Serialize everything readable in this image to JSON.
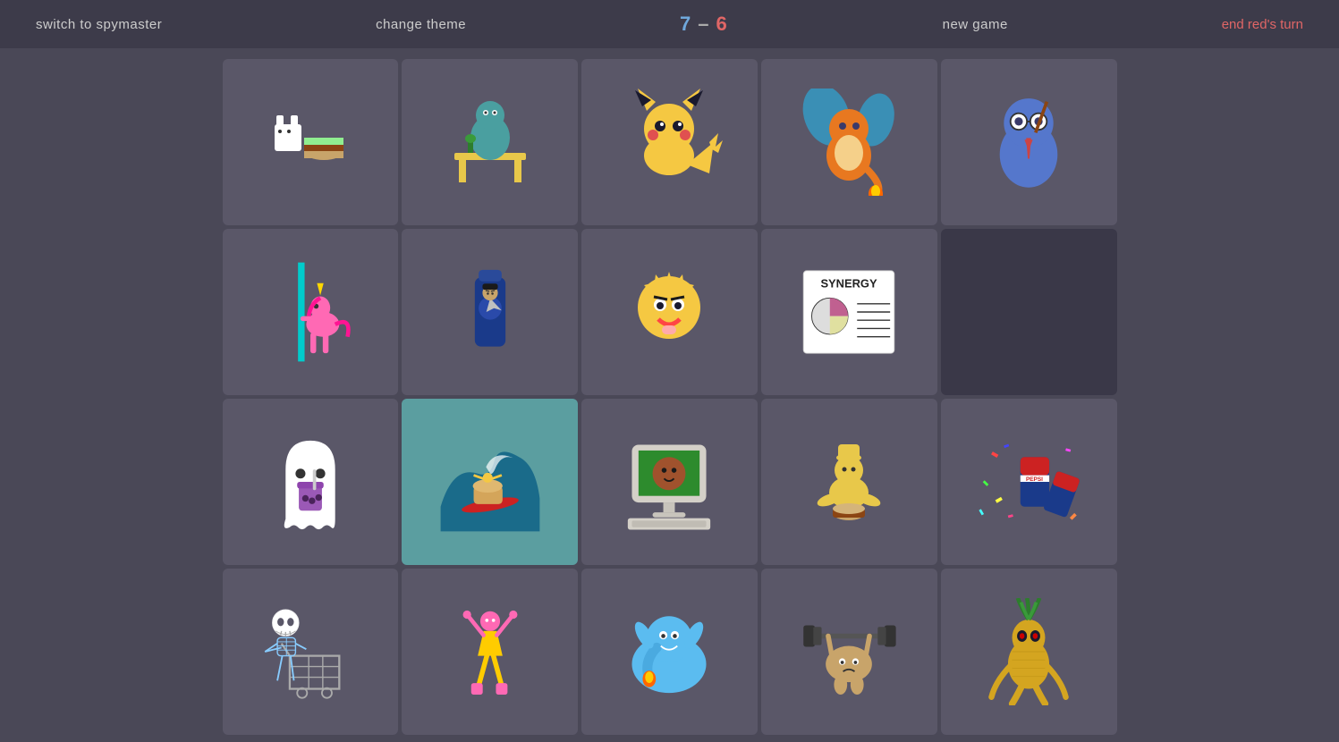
{
  "header": {
    "switch_label": "switch to spymaster",
    "theme_label": "change theme",
    "score_blue": "7",
    "score_sep": "–",
    "score_red": "6",
    "new_game_label": "new game",
    "end_turn_label": "end red's turn"
  },
  "cards": [
    {
      "id": 0,
      "emoji": "🐱🍔",
      "label": "cat burger",
      "bg": "#5a5768"
    },
    {
      "id": 1,
      "emoji": "🦕💻",
      "label": "dino desk",
      "bg": "#5a5768"
    },
    {
      "id": 2,
      "emoji": "⚡🐭",
      "label": "pikachu",
      "bg": "#5a5768"
    },
    {
      "id": 3,
      "emoji": "🐉🔥",
      "label": "charizard",
      "bg": "#5a5768"
    },
    {
      "id": 4,
      "emoji": "🦉🎓",
      "label": "owl professor",
      "bg": "#5a5768"
    },
    {
      "id": 5,
      "emoji": "🦄💃",
      "label": "unicorn pole",
      "bg": "#5a5768"
    },
    {
      "id": 6,
      "emoji": "🖖🧴",
      "label": "spock bottle",
      "bg": "#5a5768"
    },
    {
      "id": 7,
      "emoji": "⭐😤",
      "label": "maggie simpson",
      "bg": "#5a5768"
    },
    {
      "id": 8,
      "emoji": "📊✏️",
      "label": "synergy chart",
      "bg": "#5a5768"
    },
    {
      "id": 9,
      "emoji": "🌑",
      "label": "dark card",
      "bg": "#5a5768"
    },
    {
      "id": 10,
      "emoji": "👻🧋",
      "label": "ghost boba",
      "bg": "#5a5768"
    },
    {
      "id": 11,
      "emoji": "🌊🍞",
      "label": "bread surfing",
      "bg": "#5a5768"
    },
    {
      "id": 12,
      "emoji": "💻👶",
      "label": "old computer",
      "bg": "#5a5768"
    },
    {
      "id": 13,
      "emoji": "🥁🧘",
      "label": "meditating drummer",
      "bg": "#5a5768"
    },
    {
      "id": 14,
      "emoji": "🥤🎉",
      "label": "pepsi confetti",
      "bg": "#5a5768"
    },
    {
      "id": 15,
      "emoji": "💀🛒",
      "label": "skeleton shopping",
      "bg": "#5a5768"
    },
    {
      "id": 16,
      "emoji": "🤸‍♀️",
      "label": "gymnast",
      "bg": "#5a5768"
    },
    {
      "id": 17,
      "emoji": "🐘💙",
      "label": "blue elephant",
      "bg": "#5a5768"
    },
    {
      "id": 18,
      "emoji": "🥔🏋️",
      "label": "potato lifting",
      "bg": "#5a5768"
    },
    {
      "id": 19,
      "emoji": "🍍👽",
      "label": "pineapple alien",
      "bg": "#5a5768"
    }
  ]
}
